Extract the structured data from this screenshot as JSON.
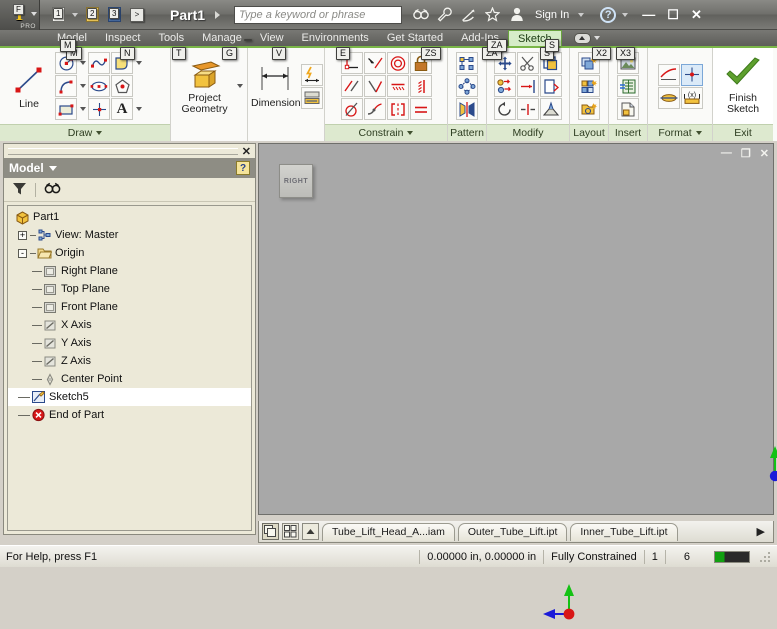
{
  "titlebar": {
    "app_glyph": "I",
    "app_kb": "F",
    "app_sub": "PRO",
    "document_title": "Part1",
    "search_placeholder": "Type a keyword or phrase",
    "search_value": "",
    "signin_label": "Sign In",
    "help_label": "?",
    "quick_access": [
      {
        "name": "new-document",
        "kb": "1"
      },
      {
        "name": "open-document",
        "kb": "2"
      },
      {
        "name": "save-document",
        "kb": "3"
      },
      {
        "name": "qat-more",
        "kb": ">"
      }
    ],
    "window_controls": {
      "minimize": "—",
      "maximize": "☐",
      "close": "✕"
    }
  },
  "ribbon": {
    "tabs": [
      {
        "label": "Model",
        "kb": "M",
        "active": false
      },
      {
        "label": "Inspect",
        "kb": "N",
        "active": false
      },
      {
        "label": "Tools",
        "kb": "T",
        "active": false
      },
      {
        "label": "Manage",
        "kb": "G",
        "active": false
      },
      {
        "label": "View",
        "kb": "V",
        "active": false
      },
      {
        "label": "Environments",
        "kb": "E",
        "active": false
      },
      {
        "label": "Get Started",
        "kb": "ZS",
        "active": false
      },
      {
        "label": "Add-Ins",
        "kb": "ZA",
        "active": false
      },
      {
        "label": "Sketch",
        "kb": "S",
        "active": true
      }
    ],
    "minimize_kb_left": "X2",
    "minimize_kb_right": "X3",
    "panels": [
      {
        "label": "Draw",
        "has_dropdown": true,
        "kb_over": "M"
      },
      {
        "label": "Pattern",
        "has_dropdown": false,
        "kb_over": ""
      },
      {
        "label": "Modify",
        "has_dropdown": false,
        "kb_over": ""
      },
      {
        "label": "Layout",
        "has_dropdown": false,
        "kb_over": ""
      },
      {
        "label": "Insert",
        "has_dropdown": false,
        "kb_over": ""
      },
      {
        "label": "Format",
        "has_dropdown": true,
        "kb_over": ""
      },
      {
        "label": "Exit",
        "has_dropdown": false,
        "kb_over": ""
      },
      {
        "label": "Constrain",
        "has_dropdown": true,
        "kb_over": "E"
      }
    ],
    "draw": {
      "line_label": "Line",
      "tools": [
        "circle-tool",
        "spline-tool",
        "fillet-region-tool",
        "arc-tool",
        "ellipse-tool",
        "polygon-tool",
        "rectangle-tool",
        "point-tool",
        "text-tool"
      ]
    },
    "project_geometry": {
      "label_line1": "Project",
      "label_line2": "Geometry"
    },
    "dimension": {
      "label": "Dimension"
    },
    "constrain": {
      "tools": [
        "coincident-constraint",
        "collinear-constraint",
        "concentric-constraint",
        "fix-constraint",
        "parallel-constraint",
        "perpendicular-constraint",
        "horizontal-constraint",
        "vertical-constraint",
        "tangent-constraint",
        "smooth-constraint",
        "symmetric-constraint",
        "equal-constraint"
      ]
    },
    "pattern": {
      "tools": [
        "rectangular-pattern",
        "circular-pattern",
        "mirror"
      ]
    },
    "modify": {
      "tools": [
        "move",
        "copy",
        "rotate",
        "trim",
        "extend",
        "split",
        "scale",
        "stretch",
        "offset"
      ]
    },
    "layout": {
      "tools": [
        "create-block",
        "insert-block",
        "edit-block"
      ]
    },
    "insert": {
      "tools": [
        "insert-image",
        "insert-ole-object",
        "insert-points"
      ]
    },
    "format": {
      "tools": [
        "construction-line",
        "center-line",
        "center-point",
        "driven-dimension"
      ]
    },
    "exit": {
      "label_line1": "Finish",
      "label_line2": "Sketch"
    }
  },
  "browser": {
    "panel_title": "Model",
    "help_glyph": "?",
    "close_glyph": "✕",
    "toolbar": [
      "filter-icon",
      "search-icon"
    ],
    "tree": [
      {
        "label": "Part1",
        "depth": 0,
        "icon": "part-icon",
        "expander": "",
        "selected": false
      },
      {
        "label": "View: Master",
        "depth": 1,
        "icon": "view-icon",
        "expander": "+",
        "selected": false
      },
      {
        "label": "Origin",
        "depth": 1,
        "icon": "folder-icon",
        "expander": "-",
        "selected": false
      },
      {
        "label": "Right Plane",
        "depth": 2,
        "icon": "plane-icon",
        "expander": "",
        "selected": false
      },
      {
        "label": "Top Plane",
        "depth": 2,
        "icon": "plane-icon",
        "expander": "",
        "selected": false
      },
      {
        "label": "Front Plane",
        "depth": 2,
        "icon": "plane-icon",
        "expander": "",
        "selected": false
      },
      {
        "label": "X Axis",
        "depth": 2,
        "icon": "axis-icon",
        "expander": "",
        "selected": false
      },
      {
        "label": "Y Axis",
        "depth": 2,
        "icon": "axis-icon",
        "expander": "",
        "selected": false
      },
      {
        "label": "Z Axis",
        "depth": 2,
        "icon": "axis-icon",
        "expander": "",
        "selected": false
      },
      {
        "label": "Center Point",
        "depth": 2,
        "icon": "center-point-icon",
        "expander": "",
        "selected": false
      },
      {
        "label": "Sketch5",
        "depth": 1,
        "icon": "sketch-icon",
        "expander": "",
        "selected": true
      },
      {
        "label": "End of Part",
        "depth": 1,
        "icon": "end-of-part-icon",
        "expander": "",
        "selected": false
      }
    ]
  },
  "canvas": {
    "viewcube_label": "RIGHT",
    "mdi_controls": {
      "minimize": "—",
      "restore": "❐",
      "close": "✕"
    },
    "origin_marker": {
      "name": "sketch-origin-marker",
      "x_axis_color": "#e01b1b",
      "y_axis_color": "#14c214",
      "point_color": "#1a1ad8"
    },
    "csys_marker": {
      "name": "coordinate-system-indicator",
      "x_axis_color": "#1a1ad8",
      "y_axis_color": "#14c214",
      "point_color": "#d81616"
    }
  },
  "doctabs": {
    "icons": [
      "cascade-windows-icon",
      "tile-windows-icon",
      "scroll-up-icon"
    ],
    "tabs": [
      {
        "label": "Tube_Lift_Head_A...iam",
        "active": false
      },
      {
        "label": "Outer_Tube_Lift.ipt",
        "active": false
      },
      {
        "label": "Inner_Tube_Lift.ipt",
        "active": false
      }
    ],
    "next_glyph": "▶"
  },
  "statusbar": {
    "help_text": "For Help, press F1",
    "coordinates": "0.00000 in, 0.00000 in",
    "constraint_state": "Fully Constrained",
    "dimension_count": "1",
    "element_count": "6"
  },
  "colors": {
    "ribbon_accent": "#7ab648",
    "active_tab_bg": "#d6ecc8",
    "panel_label_bg": "#dde9cf",
    "canvas_bg": "#a8a8a8",
    "browser_bg": "#ece9d8",
    "titlebar_bg": "#6f6f6b"
  }
}
